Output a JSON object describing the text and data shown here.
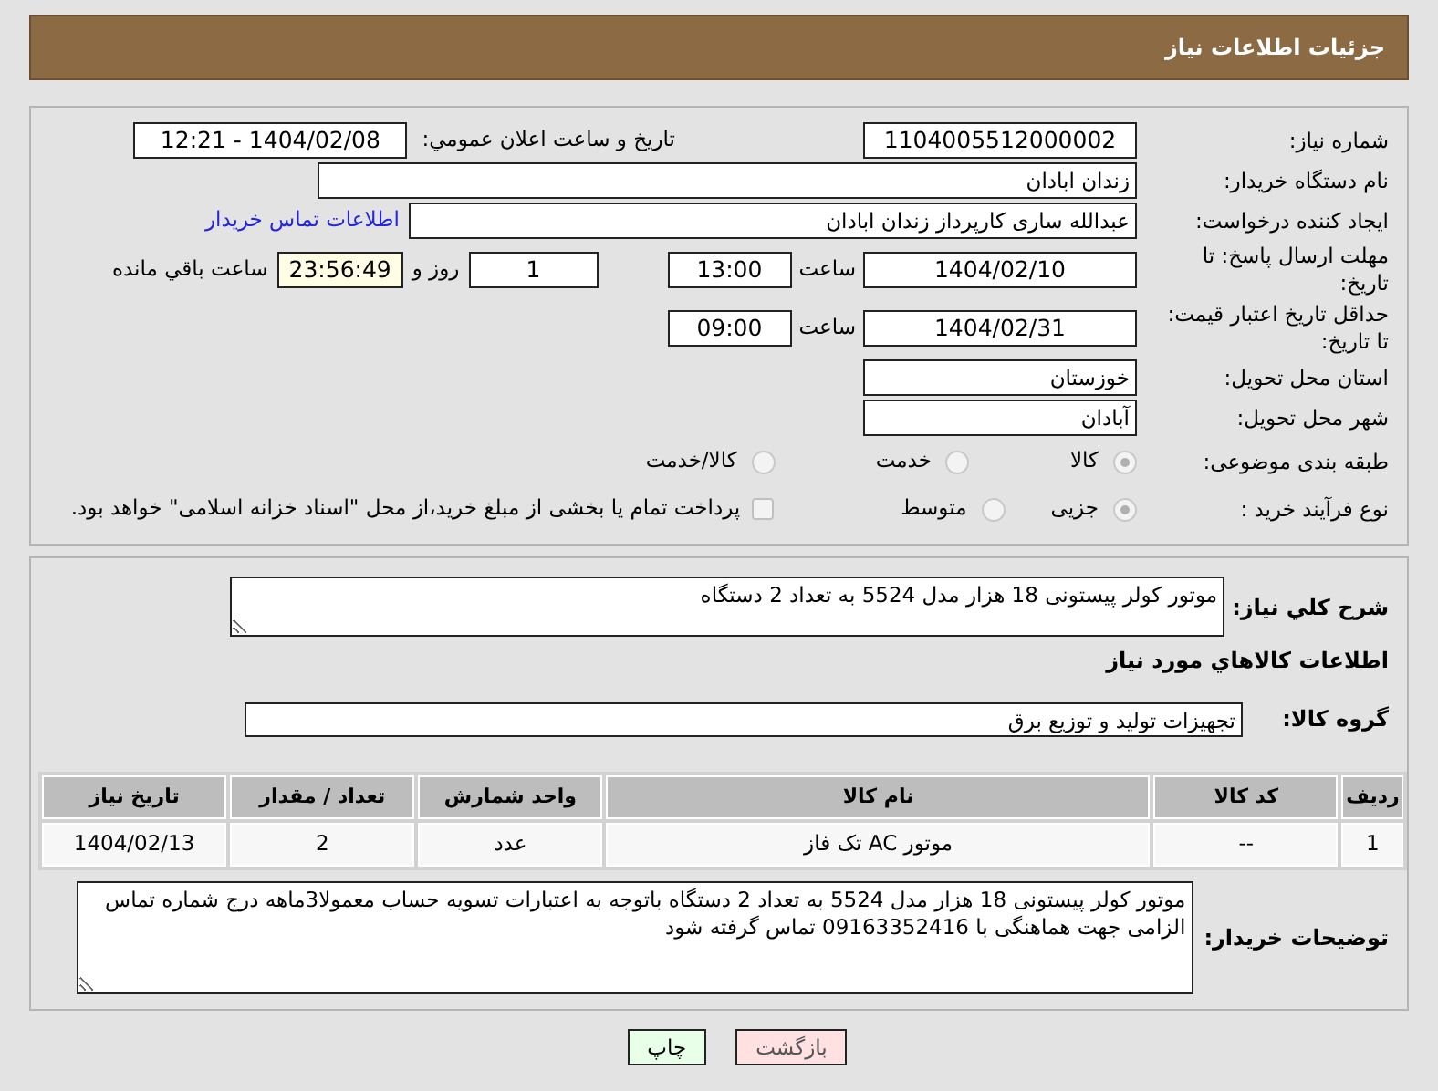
{
  "header": {
    "title": "جزئیات اطلاعات نیاز"
  },
  "need_number": {
    "label": "شماره نیاز:",
    "value": "1104005512000002"
  },
  "announcement": {
    "label": "تاریخ و ساعت اعلان عمومي:",
    "value": "1404/02/08 - 12:21"
  },
  "buyer_org": {
    "label": "نام دستگاه خریدار:",
    "value": "زندان ابادان"
  },
  "requester": {
    "label": "ایجاد کننده درخواست:",
    "value": "عبدالله ساری کارپرداز زندان ابادان",
    "link": "اطلاعات تماس خریدار"
  },
  "reply_deadline": {
    "label": "مهلت ارسال پاسخ: تا تاریخ:",
    "date": "1404/02/10",
    "time_label": "ساعت",
    "time": "13:00",
    "days": "1",
    "days_label": "روز و",
    "remaining": "23:56:49",
    "remaining_label": "ساعت باقي مانده"
  },
  "price_validity": {
    "label": "حداقل تاریخ اعتبار قیمت: تا تاریخ:",
    "date": "1404/02/31",
    "time_label": "ساعت",
    "time": "09:00"
  },
  "province": {
    "label": "استان محل تحویل:",
    "value": "خوزستان"
  },
  "city": {
    "label": "شهر محل تحویل:",
    "value": "آبادان"
  },
  "category": {
    "label": "طبقه بندی موضوعی:",
    "options": [
      {
        "label": "کالا",
        "selected": true
      },
      {
        "label": "خدمت",
        "selected": false
      },
      {
        "label": "کالا/خدمت",
        "selected": false
      }
    ]
  },
  "purchase_type": {
    "label": "نوع فرآیند خرید :",
    "options": [
      {
        "label": "جزیی",
        "selected": true
      },
      {
        "label": "متوسط",
        "selected": false
      }
    ],
    "treasury": {
      "label": "پرداخت تمام یا بخشی از مبلغ خرید،از محل \"اسناد خزانه اسلامی\" خواهد بود.",
      "checked": false
    }
  },
  "description": {
    "label": "شرح کلي نیاز:",
    "value": "موتور کولر پیستونی 18 هزار مدل 5524 به تعداد 2 دستگاه"
  },
  "goods_section": {
    "title": "اطلاعات کالاهاي مورد نیاز"
  },
  "goods_group": {
    "label": "گروه کالا:",
    "value": "تجهیزات تولید و توزیع برق"
  },
  "table": {
    "columns": [
      "ردیف",
      "کد کالا",
      "نام کالا",
      "واحد شمارش",
      "تعداد / مقدار",
      "تاریخ نیاز"
    ],
    "rows": [
      [
        "1",
        "--",
        "موتور AC تک فاز",
        "عدد",
        "2",
        "1404/02/13"
      ]
    ]
  },
  "buyer_notes": {
    "label": "توضیحات خریدار:",
    "value": "موتور کولر پیستونی 18 هزار مدل 5524 به تعداد 2 دستگاه باتوجه به اعتبارات تسویه حساب معمولا3ماهه درج شماره تماس الزامی جهت هماهنگی با 09163352416 تماس گرفته شود"
  },
  "buttons": [
    {
      "label": "بازگشت",
      "kind": "back"
    },
    {
      "label": "چاپ",
      "kind": "print"
    }
  ]
}
